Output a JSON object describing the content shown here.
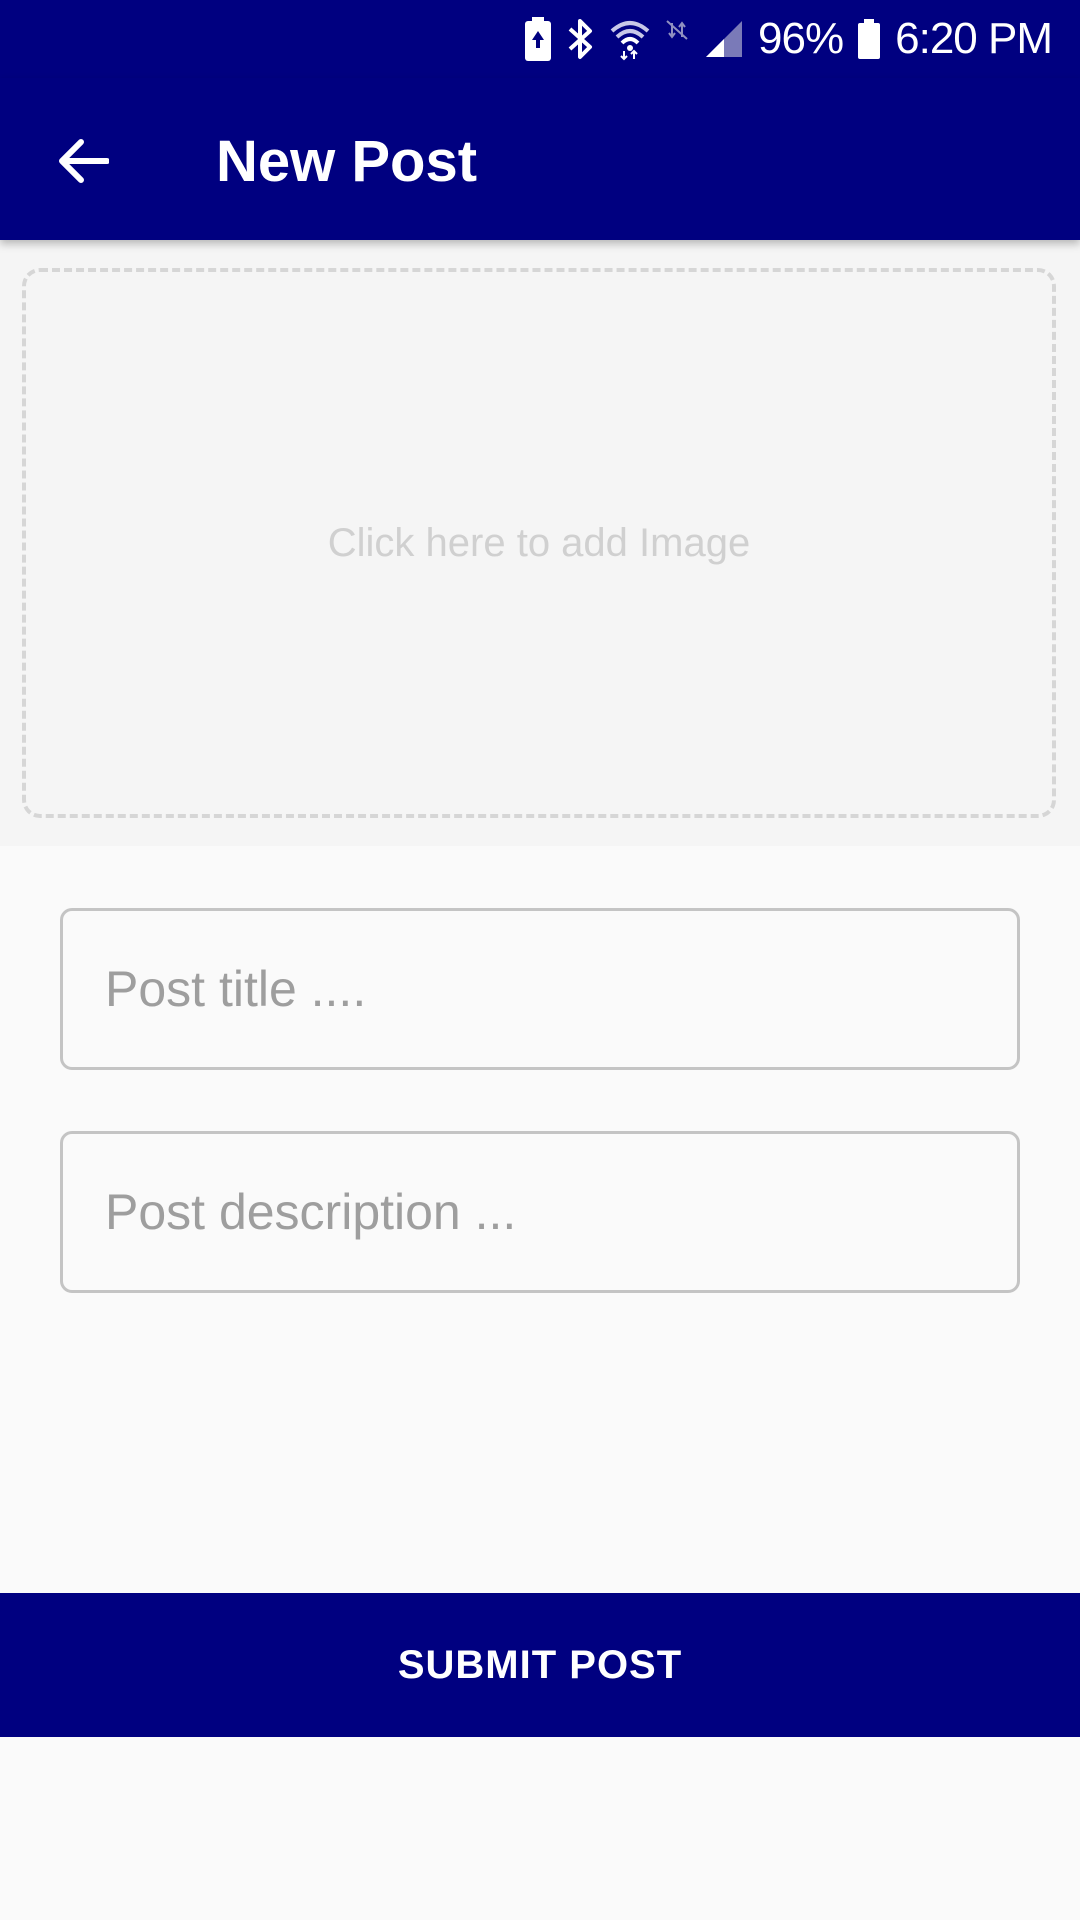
{
  "colors": {
    "primary": "#000080",
    "background": "#fafafa",
    "image_area": "#f5f5f5",
    "placeholder": "#9e9e9e"
  },
  "status_bar": {
    "icons": [
      "battery-saver-icon",
      "bluetooth-icon",
      "wifi-icon",
      "data-off-icon",
      "signal-icon",
      "battery-icon"
    ],
    "battery_percent": "96%",
    "time": "6:20 PM"
  },
  "app_bar": {
    "back_icon": "arrow-left-icon",
    "title": "New Post"
  },
  "image_picker": {
    "label": "Click here to add Image"
  },
  "form": {
    "title_placeholder": "Post title ....",
    "title_value": "",
    "description_placeholder": "Post description ...",
    "description_value": ""
  },
  "submit": {
    "label": "SUBMIT POST"
  }
}
